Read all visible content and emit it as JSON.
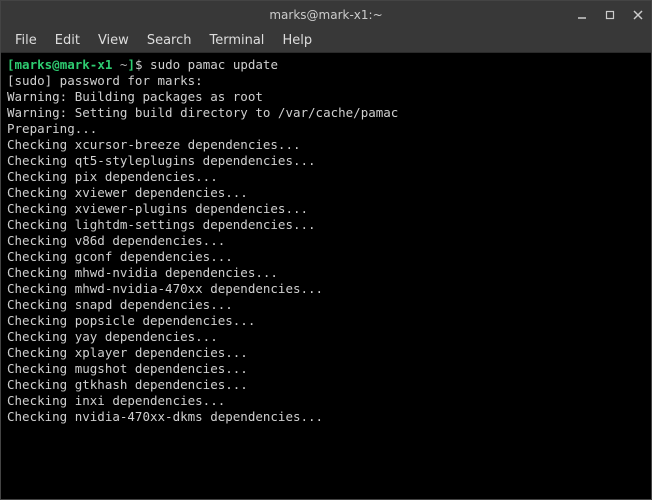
{
  "titlebar": {
    "title": "marks@mark-x1:~"
  },
  "menubar": {
    "items": [
      "File",
      "Edit",
      "View",
      "Search",
      "Terminal",
      "Help"
    ]
  },
  "prompt": {
    "open": "[",
    "user": "marks",
    "at": "@",
    "host": "mark-x1",
    "path": " ~",
    "close": "]",
    "dollar": "$ "
  },
  "command": "sudo pamac update",
  "output": [
    "[sudo] password for marks:",
    "Warning: Building packages as root",
    "Warning: Setting build directory to /var/cache/pamac",
    "Preparing...",
    "Checking xcursor-breeze dependencies...",
    "Checking qt5-styleplugins dependencies...",
    "Checking pix dependencies...",
    "Checking xviewer dependencies...",
    "Checking xviewer-plugins dependencies...",
    "Checking lightdm-settings dependencies...",
    "Checking v86d dependencies...",
    "Checking gconf dependencies...",
    "Checking mhwd-nvidia dependencies...",
    "Checking mhwd-nvidia-470xx dependencies...",
    "Checking snapd dependencies...",
    "Checking popsicle dependencies...",
    "Checking yay dependencies...",
    "Checking xplayer dependencies...",
    "Checking mugshot dependencies...",
    "Checking gtkhash dependencies...",
    "Checking inxi dependencies...",
    "Checking nvidia-470xx-dkms dependencies..."
  ]
}
